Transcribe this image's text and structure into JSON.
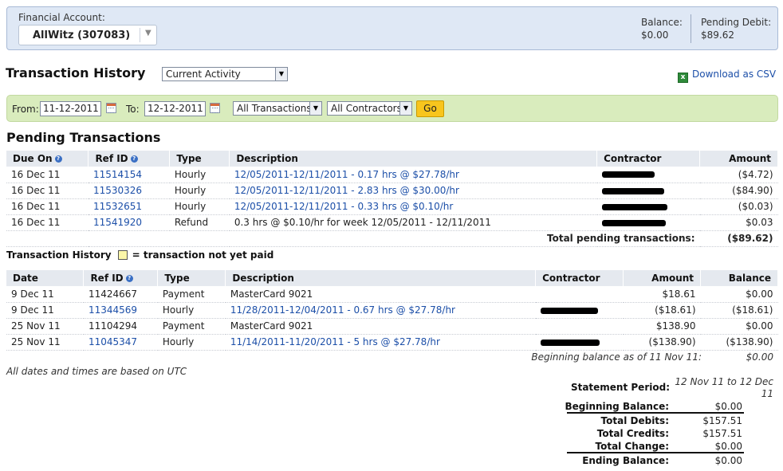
{
  "account": {
    "label": "Financial Account:",
    "selected": "AllWitz (307083)",
    "balance_label": "Balance:",
    "balance_value": "$0.00",
    "pending_label": "Pending Debit:",
    "pending_value": "$89.62"
  },
  "header": {
    "title": "Transaction History",
    "activity_select": "Current Activity",
    "csv_link": "Download as CSV"
  },
  "filters": {
    "from_label": "From:",
    "from_value": "11-12-2011",
    "to_label": "To:",
    "to_value": "12-12-2011",
    "transactions_select": "All Transactions",
    "contractors_select": "All Contractors",
    "go_label": "Go"
  },
  "pending": {
    "title": "Pending Transactions",
    "columns": {
      "due_on": "Due On",
      "ref_id": "Ref ID",
      "type": "Type",
      "description": "Description",
      "contractor": "Contractor",
      "amount": "Amount"
    },
    "rows": [
      {
        "due_on": "16 Dec 11",
        "ref_id": "11514154",
        "type": "Hourly",
        "description": "12/05/2011-12/11/2011 - 0.17 hrs @ $27.78/hr",
        "amount": "($4.72)"
      },
      {
        "due_on": "16 Dec 11",
        "ref_id": "11530326",
        "type": "Hourly",
        "description": "12/05/2011-12/11/2011 - 2.83 hrs @ $30.00/hr",
        "amount": "($84.90)"
      },
      {
        "due_on": "16 Dec 11",
        "ref_id": "11532651",
        "type": "Hourly",
        "description": "12/05/2011-12/11/2011 - 0.33 hrs @ $0.10/hr",
        "amount": "($0.03)"
      },
      {
        "due_on": "16 Dec 11",
        "ref_id": "11541920",
        "type": "Refund",
        "description": "0.3 hrs @ $0.10/hr for week 12/05/2011 - 12/11/2011",
        "amount": "$0.03"
      }
    ],
    "total_label": "Total pending transactions:",
    "total_value": "($89.62)"
  },
  "history": {
    "label": "Transaction History",
    "legend_text": "= transaction not yet paid",
    "columns": {
      "date": "Date",
      "ref_id": "Ref ID",
      "type": "Type",
      "description": "Description",
      "contractor": "Contractor",
      "amount": "Amount",
      "balance": "Balance"
    },
    "rows": [
      {
        "date": "9 Dec 11",
        "ref_id": "11424667",
        "type": "Payment",
        "description": "MasterCard 9021",
        "amount": "$18.61",
        "balance": "$0.00"
      },
      {
        "date": "9 Dec 11",
        "ref_id": "11344569",
        "type": "Hourly",
        "description": "11/28/2011-12/04/2011 - 0.67 hrs @ $27.78/hr",
        "amount": "($18.61)",
        "balance": "($18.61)"
      },
      {
        "date": "25 Nov 11",
        "ref_id": "11104294",
        "type": "Payment",
        "description": "MasterCard 9021",
        "amount": "$138.90",
        "balance": "$0.00"
      },
      {
        "date": "25 Nov 11",
        "ref_id": "11045347",
        "type": "Hourly",
        "description": "11/14/2011-11/20/2011 - 5 hrs @ $27.78/hr",
        "amount": "($138.90)",
        "balance": "($138.90)"
      }
    ],
    "beginning_label": "Beginning balance as of 11 Nov 11:",
    "beginning_value": "$0.00"
  },
  "utc_note": "All dates and times are based on UTC",
  "statement": {
    "period_label": "Statement Period:",
    "period_value": "12 Nov 11 to 12 Dec 11",
    "rows": [
      {
        "label": "Beginning Balance:",
        "value": "$0.00"
      },
      {
        "label": "Total Debits:",
        "value": "$157.51"
      },
      {
        "label": "Total Credits:",
        "value": "$157.51"
      },
      {
        "label": "Total Change:",
        "value": "$0.00"
      },
      {
        "label": "Ending Balance:",
        "value": "$0.00"
      }
    ]
  }
}
